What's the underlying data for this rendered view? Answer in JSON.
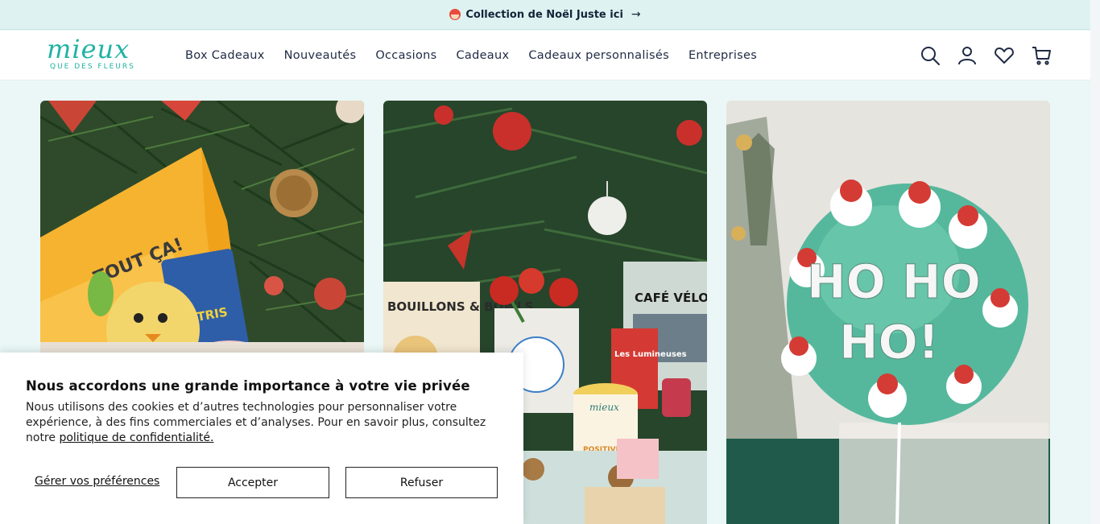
{
  "promo": {
    "text": "Collection de Noël Juste ici",
    "arrow": "→"
  },
  "logo": {
    "word": "mieux",
    "tagline": "QUE DES FLEURS"
  },
  "nav": {
    "items": [
      {
        "label": "Box Cadeaux"
      },
      {
        "label": "Nouveautés"
      },
      {
        "label": "Occasions"
      },
      {
        "label": "Cadeaux"
      },
      {
        "label": "Cadeaux personnalisés"
      },
      {
        "label": "Entreprises"
      }
    ]
  },
  "header_icons": [
    "search-icon",
    "account-icon",
    "wishlist-heart-icon",
    "cart-icon"
  ],
  "cards": {
    "card1": {
      "box_text": "TOUT ÇA!",
      "snack_text": "TETRIS"
    },
    "card2": {
      "book1": "BOUILLONS & BOWLS",
      "book2": "CAFÉ VÉLO",
      "box_text": "Les Lumineuses",
      "mug_text": "mieux",
      "label2": "POSITIVES"
    },
    "card3": {
      "balloon_line1": "HO HO",
      "balloon_line2": "HO!"
    }
  },
  "cookie": {
    "title": "Nous accordons une grande importance à votre vie privée",
    "body": "Nous utilisons des cookies et d’autres technologies pour personnaliser votre expérience, à des fins commerciales et d’analyses. Pour en savoir plus, consultez notre ",
    "link": "politique de confidentialité.",
    "manage": "Gérer vos préférences",
    "accept": "Accepter",
    "refuse": "Refuser"
  },
  "colors": {
    "brand": "#20b3a3",
    "promo_bg": "#def3f1",
    "page_bg": "#eaf7f6",
    "nav_text": "#1f2a44"
  }
}
